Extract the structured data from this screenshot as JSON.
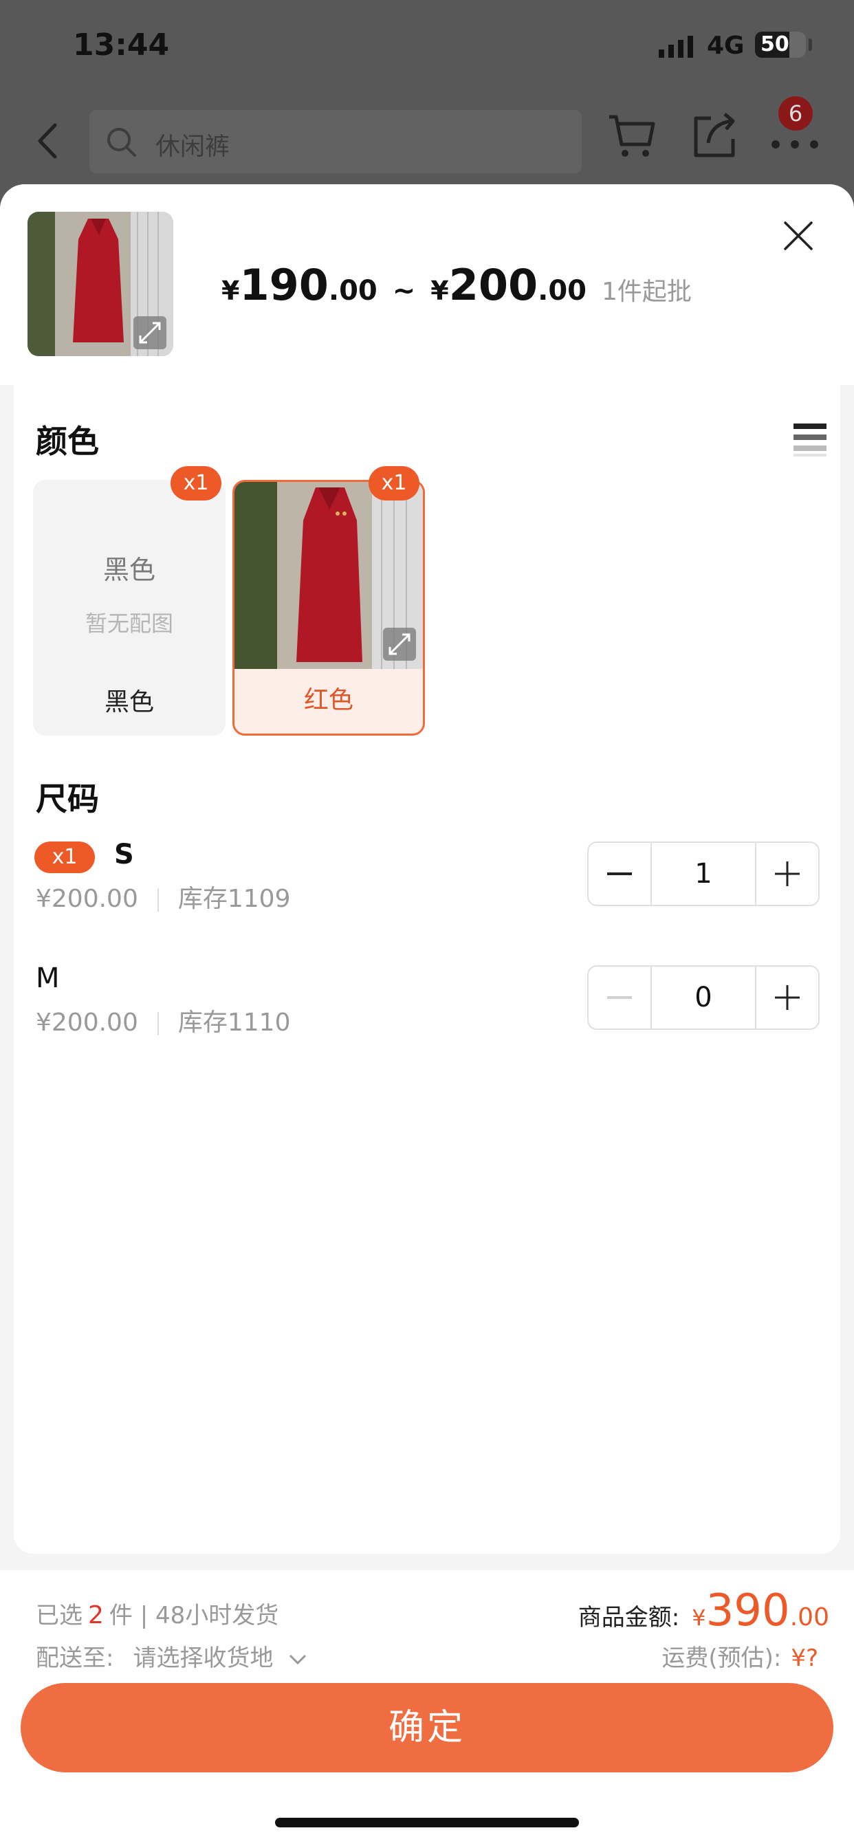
{
  "status_bar": {
    "time": "13:44",
    "network": "4G",
    "battery": "50"
  },
  "nav": {
    "search_placeholder": "休闲裤",
    "badge_count": "6"
  },
  "sheet": {
    "price_currency": "¥",
    "price_min_int": "190",
    "price_min_dec": ".00",
    "price_sep": "~",
    "price_max_int": "200",
    "price_max_dec": ".00",
    "moq": "1件起批"
  },
  "color_section": {
    "title": "颜色",
    "options": [
      {
        "label": "黑色",
        "placeholder_title": "黑色",
        "placeholder_sub": "暂无配图",
        "qty_badge": "x1",
        "selected": false
      },
      {
        "label": "红色",
        "qty_badge": "x1",
        "selected": true
      }
    ]
  },
  "size_section": {
    "title": "尺码",
    "rows": [
      {
        "badge": "x1",
        "name": "S",
        "price": "¥200.00",
        "stock": "库存1109",
        "qty": "1"
      },
      {
        "name": "M",
        "price": "¥200.00",
        "stock": "库存1110",
        "qty": "0"
      }
    ]
  },
  "footer": {
    "selected_prefix": "已选",
    "selected_count": "2",
    "selected_suffix": "件 | 48小时发货",
    "ship_label": "配送至:",
    "ship_addr": "请选择收货地",
    "amount_label": "商品金额:",
    "amount_currency": "¥",
    "amount_int": "390",
    "amount_dec": ".00",
    "freight_label": "运费(预估):",
    "freight_value": "¥?",
    "confirm": "确定"
  },
  "colors": {
    "accent": "#ED5A27",
    "button": "#EF6D40",
    "price_red": "#E0352A"
  }
}
